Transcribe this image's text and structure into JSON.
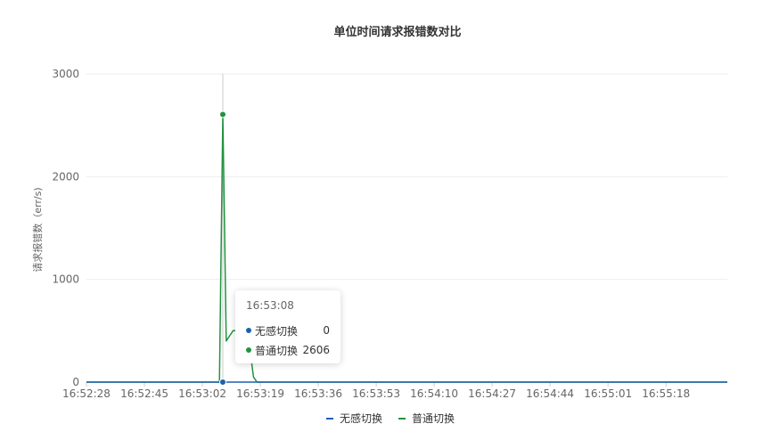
{
  "chart_data": {
    "type": "line",
    "title": "单位时间请求报错数对比",
    "ylabel": "请求报错数（err/s)",
    "xlabel": "",
    "ylim": [
      0,
      3000
    ],
    "yticks": [
      "0",
      "1000",
      "2000",
      "3000"
    ],
    "x_tick_labels": [
      "16:52:28",
      "16:52:45",
      "16:53:02",
      "16:53:19",
      "16:53:36",
      "16:53:53",
      "16:54:10",
      "16:54:27",
      "16:54:44",
      "16:55:01",
      "16:55:18"
    ],
    "x_range": [
      "16:52:28",
      "16:55:36"
    ],
    "grid": true,
    "legend_position": "bottom",
    "series": [
      {
        "name": "无感切换",
        "color": "#1f5fb0",
        "points": [
          [
            "16:52:28",
            0
          ],
          [
            "16:53:08",
            0
          ],
          [
            "16:53:18",
            0
          ],
          [
            "16:55:36",
            0
          ]
        ]
      },
      {
        "name": "普通切换",
        "color": "#22933f",
        "points": [
          [
            "16:52:28",
            0
          ],
          [
            "16:53:06",
            0
          ],
          [
            "16:53:07",
            0
          ],
          [
            "16:53:08",
            2606
          ],
          [
            "16:53:09",
            400
          ],
          [
            "16:53:10",
            450
          ],
          [
            "16:53:11",
            500
          ],
          [
            "16:53:15",
            500
          ],
          [
            "16:53:16",
            300
          ],
          [
            "16:53:17",
            50
          ],
          [
            "16:53:18",
            0
          ],
          [
            "16:55:36",
            0
          ]
        ]
      }
    ],
    "tooltip": {
      "time": "16:53:08",
      "rows": [
        {
          "name": "无感切换",
          "value": "0",
          "color": "#1f5fb0"
        },
        {
          "name": "普通切换",
          "value": "2606",
          "color": "#22933f"
        }
      ]
    }
  }
}
